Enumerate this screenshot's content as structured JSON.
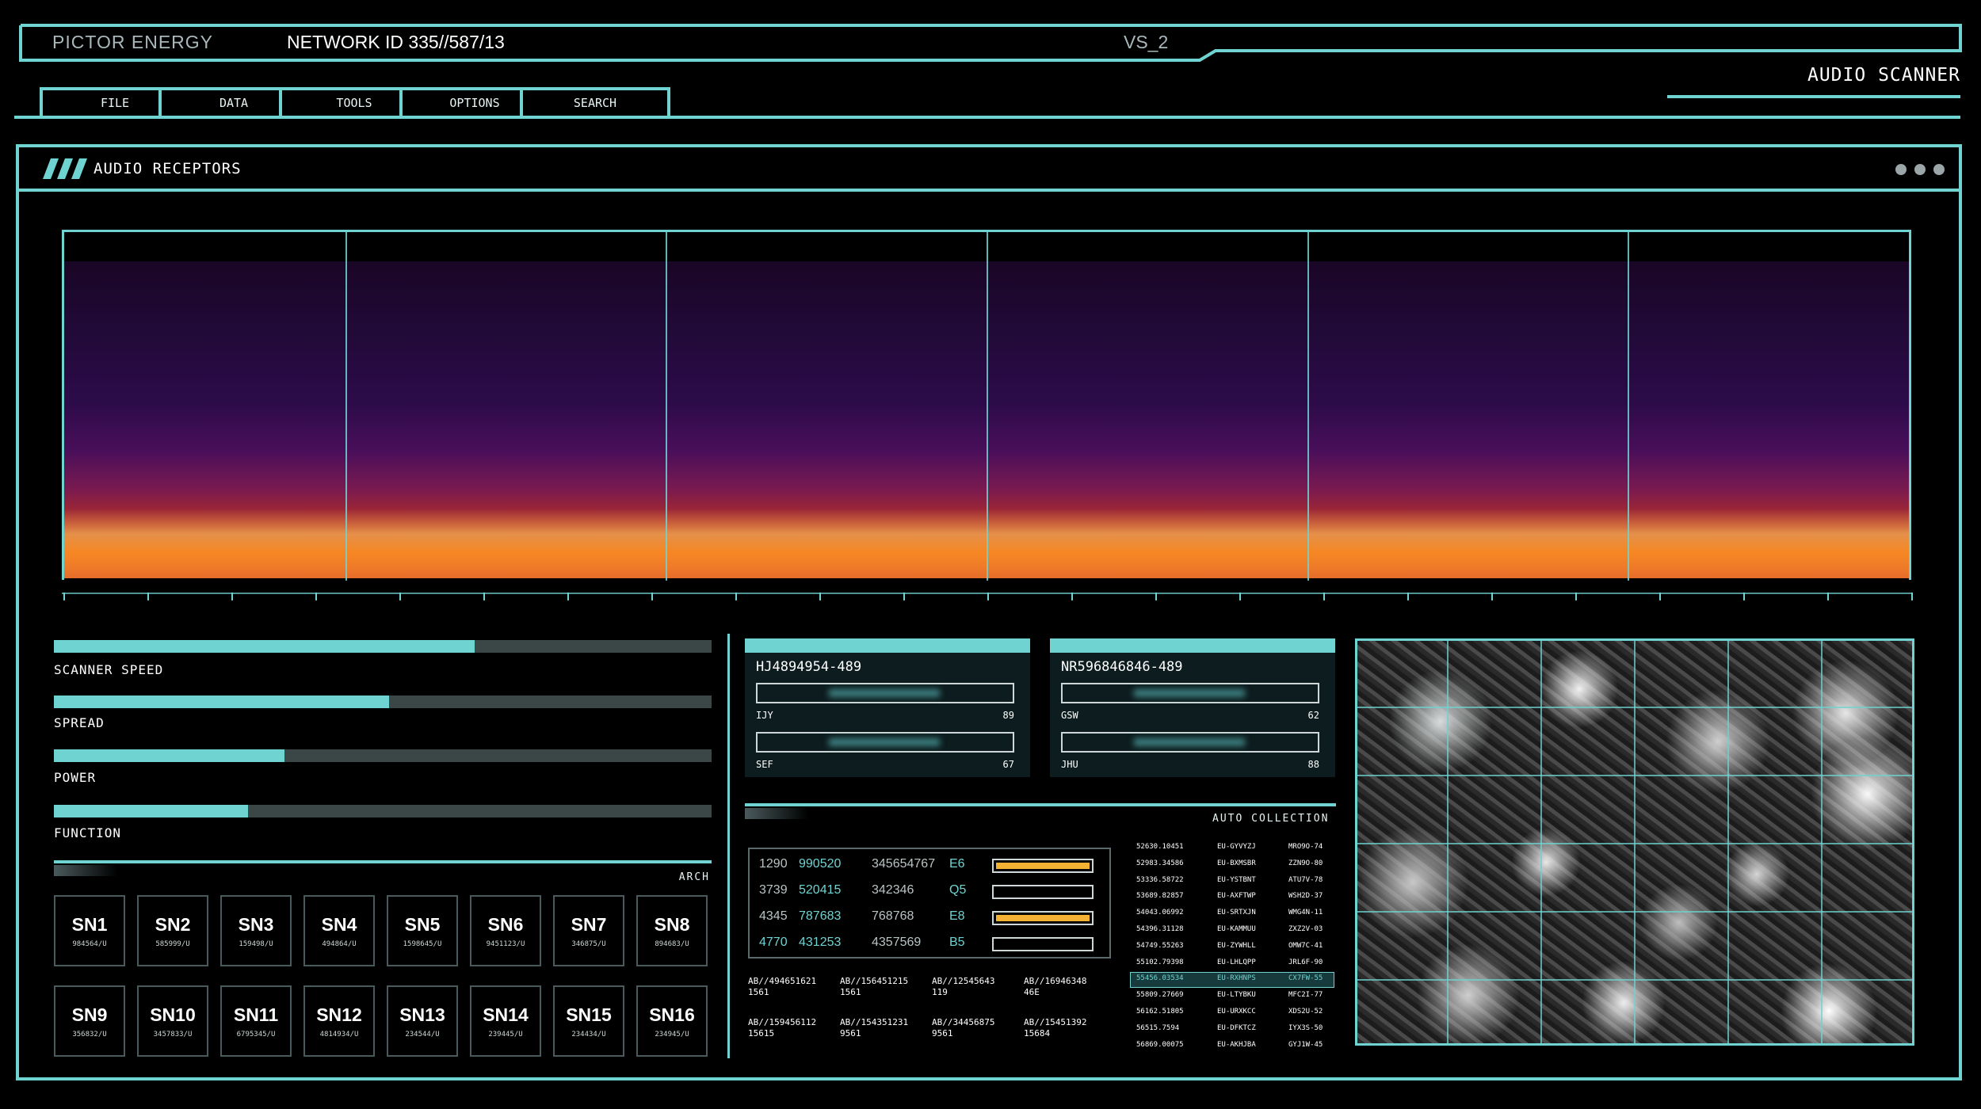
{
  "header": {
    "brand": "PICTOR ENERGY",
    "network": "NETWORK ID 335//587/13",
    "version": "VS_2",
    "app_title": "AUDIO SCANNER"
  },
  "menu": [
    "FILE",
    "DATA",
    "TOOLS",
    "OPTIONS",
    "SEARCH"
  ],
  "panel": {
    "title": "AUDIO RECEPTORS",
    "menu_icon": "more-dots-icon"
  },
  "sliders": [
    {
      "label": "SCANNER SPEED",
      "value": 0.64
    },
    {
      "label": "SPREAD",
      "value": 0.51
    },
    {
      "label": "POWER",
      "value": 0.35
    },
    {
      "label": "FUNCTION",
      "value": 0.295
    }
  ],
  "sensors": {
    "section_label": "ARCH",
    "items": [
      {
        "name": "SN1",
        "code": "984564/U"
      },
      {
        "name": "SN2",
        "code": "585999/U"
      },
      {
        "name": "SN3",
        "code": "159498/U"
      },
      {
        "name": "SN4",
        "code": "494864/U"
      },
      {
        "name": "SN5",
        "code": "1598645/U"
      },
      {
        "name": "SN6",
        "code": "9451123/U"
      },
      {
        "name": "SN7",
        "code": "346875/U"
      },
      {
        "name": "SN8",
        "code": "894683/U"
      },
      {
        "name": "SN9",
        "code": "356832/U"
      },
      {
        "name": "SN10",
        "code": "3457833/U"
      },
      {
        "name": "SN11",
        "code": "6795345/U"
      },
      {
        "name": "SN12",
        "code": "4814934/U"
      },
      {
        "name": "SN13",
        "code": "234544/U"
      },
      {
        "name": "SN14",
        "code": "239445/U"
      },
      {
        "name": "SN15",
        "code": "234434/U"
      },
      {
        "name": "SN16",
        "code": "234945/U"
      }
    ]
  },
  "cards": [
    {
      "id": "HJ4894954-489",
      "f1_key": "IJY",
      "f1_val": "89",
      "f2_key": "SEF",
      "f2_val": "67"
    },
    {
      "id": "NR596846846-489",
      "f1_key": "GSW",
      "f1_val": "62",
      "f2_key": "JHU",
      "f2_val": "88"
    }
  ],
  "auto_collection": {
    "label": "AUTO COLLECTION",
    "rows": [
      {
        "a": "1290",
        "b": "990520",
        "c": "345654767",
        "d": "E6",
        "bar": true
      },
      {
        "a": "3739",
        "b": "520415",
        "c": "342346",
        "d": "Q5",
        "bar": false
      },
      {
        "a": "4345",
        "b": "787683",
        "c": "768768",
        "d": "E8",
        "bar": true
      },
      {
        "a": "4770",
        "b": "431253",
        "c": "4357569",
        "d": "B5",
        "bar": false
      }
    ],
    "accent": "#f3b233"
  },
  "ab_codes": [
    {
      "code": "AB//494651621",
      "sub": "1561"
    },
    {
      "code": "AB//156451215",
      "sub": "1561"
    },
    {
      "code": "AB//12545643",
      "sub": "119"
    },
    {
      "code": "AB//16946348",
      "sub": "46E"
    },
    {
      "code": "AB//159456112",
      "sub": "15615"
    },
    {
      "code": "AB//154351231",
      "sub": "9561"
    },
    {
      "code": "AB//34456875",
      "sub": "9561"
    },
    {
      "code": "AB//15451392",
      "sub": "15684"
    }
  ],
  "list": [
    {
      "a": "52630.10451",
      "b": "EU-GYVYZJ",
      "c": "MRO9O-74"
    },
    {
      "a": "52983.34586",
      "b": "EU-BXMSBR",
      "c": "ZZN9O-80"
    },
    {
      "a": "53336.58722",
      "b": "EU-YSTBNT",
      "c": "ATU7V-78"
    },
    {
      "a": "53689.82857",
      "b": "EU-AXFTWP",
      "c": "WSH2D-37"
    },
    {
      "a": "54043.06992",
      "b": "EU-SRTXJN",
      "c": "WMG4N-11"
    },
    {
      "a": "54396.31128",
      "b": "EU-KAMMUU",
      "c": "ZXZ2V-03"
    },
    {
      "a": "54749.55263",
      "b": "EU-ZYWHLL",
      "c": "OMW7C-41"
    },
    {
      "a": "55102.79398",
      "b": "EU-LHLQPP",
      "c": "JRL6F-90"
    },
    {
      "a": "55456.03534",
      "b": "EU-RXHNPS",
      "c": "CX7FW-55",
      "selected": true
    },
    {
      "a": "55809.27669",
      "b": "EU-LTYBKU",
      "c": "MFC2I-77"
    },
    {
      "a": "56162.51805",
      "b": "EU-URXKCC",
      "c": "XDS2U-52"
    },
    {
      "a": "56515.7594",
      "b": "EU-DFKTCZ",
      "c": "IYX3S-50"
    },
    {
      "a": "56869.00075",
      "b": "EU-AKHJBA",
      "c": "GYJ1W-45"
    }
  ],
  "colors": {
    "accent": "#6fd3d1",
    "warning": "#f3b233",
    "background": "#000000"
  }
}
